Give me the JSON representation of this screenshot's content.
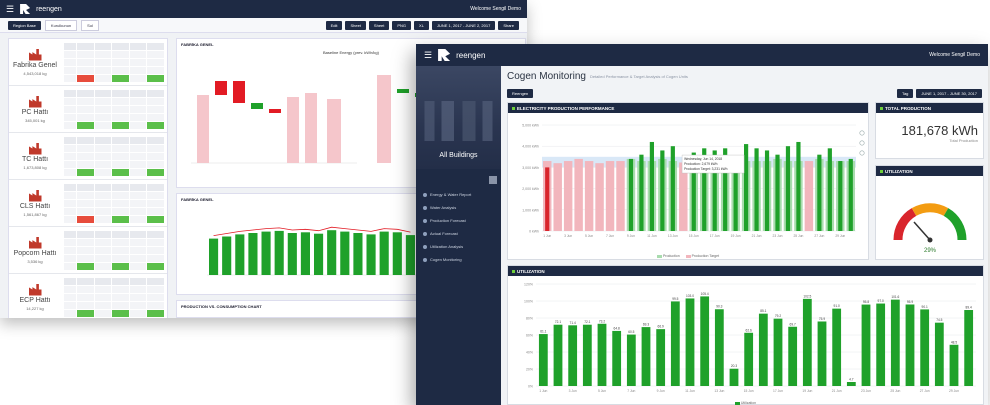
{
  "colors": {
    "navy": "#1e2a44",
    "green": "#1fa12a",
    "light_green": "#a9dcae",
    "pink": "#f2b6bd",
    "red": "#d9252c",
    "band": "#d9e8f7",
    "accent": "#6fcf3b"
  },
  "back_screen": {
    "brand": "reengen",
    "welcome": "Welcome Sengil Demo",
    "toolbar_buttons": [
      "Region Base",
      "Kurulkunun",
      "Sol"
    ],
    "right_buttons": [
      "Edit",
      "Sheet",
      "Sheet",
      "PNG",
      "XL",
      "JUNE 1, 2017 - JUNE 2, 2017",
      "Share"
    ],
    "plants": [
      {
        "name": "Fabrika Genel",
        "value": "4,543,018 kg"
      },
      {
        "name": "PC Hattı",
        "value": "345,001 kg"
      },
      {
        "name": "TC Hattı",
        "value": "1,673,808 kg"
      },
      {
        "name": "CLS Hattı",
        "value": "1,561,867 kg"
      },
      {
        "name": "Popcorn Hattı",
        "value": "3,536 kg"
      },
      {
        "name": "ECP Hattı",
        "value": "14,227 kg"
      }
    ],
    "panel1_title": "FABRİKA GENEL",
    "panel1_subtitle": "Baseline Energy (prev. kWh/kg)",
    "panel2_title": "FABRİKA GENEL",
    "panel3_title": "PRODUCTION VS. CONSUMPTION CHART"
  },
  "front_screen": {
    "brand": "reengen",
    "welcome": "Welcome Sengil Demo",
    "sidebar": {
      "hero_label": "All Buildings",
      "items": [
        "Energy & Water Report",
        "Water Analysis",
        "Production Forecast",
        "Actual Forecast",
        "Utilization Analysis",
        "Cogen Monitoring"
      ]
    },
    "page_title": "Cogen Monitoring",
    "page_subtitle": "Detailed Performance & Target Analysis of Cogen Units",
    "selector": "Reengen",
    "toolbar": {
      "tag": "Tag",
      "date_range": "JUNE 1, 2017 - JUNE 30, 2017"
    },
    "electricity_title": "ELECTRICITY PRODUCTION PERFORMANCE",
    "total_title": "TOTAL PRODUCTION",
    "total_value": "181,678 kWh",
    "total_sub": "Total Production",
    "utilization_card_title": "UTILIZATION",
    "gauge_value": "29%",
    "utilization_title": "UTILIZATION",
    "tooltip": [
      "Wednesday, Jun 14, 2018",
      "Production: 2,679 kWh",
      "Production Target: 3,231 kWh"
    ]
  },
  "chart_data": [
    {
      "type": "bar",
      "title": "ELECTRICITY PRODUCTION PERFORMANCE",
      "categories": [
        "1 Jun",
        "2 Jun",
        "3 Jun",
        "4 Jun",
        "5 Jun",
        "6 Jun",
        "7 Jun",
        "8 Jun",
        "9 Jun",
        "10 Jun",
        "11 Jun",
        "12 Jun",
        "13 Jun",
        "14 Jun",
        "15 Jun",
        "16 Jun",
        "17 Jun",
        "18 Jun",
        "19 Jun",
        "20 Jun",
        "21 Jun",
        "22 Jun",
        "23 Jun",
        "24 Jun",
        "25 Jun",
        "26 Jun",
        "27 Jun",
        "28 Jun",
        "29 Jun",
        "30 Jun"
      ],
      "series": [
        {
          "name": "Production",
          "values": [
            3000,
            2900,
            3100,
            3300,
            2500,
            2400,
            2700,
            3000,
            3400,
            3600,
            4200,
            3800,
            4000,
            1500,
            3700,
            3900,
            3800,
            3900,
            3500,
            4100,
            3900,
            3800,
            3600,
            4000,
            4200,
            2600,
            3600,
            3900,
            3300,
            3400
          ]
        },
        {
          "name": "Production Target",
          "values": [
            3300,
            3200,
            3300,
            3400,
            3300,
            3200,
            3300,
            3300,
            3400,
            3300,
            3300,
            3400,
            3300,
            3231,
            3300,
            3400,
            3300,
            3300,
            3400,
            3300,
            3300,
            3300,
            3400,
            3300,
            3300,
            3300,
            3400,
            3300,
            3300,
            3300
          ]
        }
      ],
      "legend": "bottom",
      "grid": true
    },
    {
      "type": "bar",
      "title": "UTILIZATION",
      "categories": [
        "1 Jun",
        "2 Jun",
        "3 Jun",
        "4 Jun",
        "5 Jun",
        "6 Jun",
        "7 Jun",
        "8 Jun",
        "9 Jun",
        "10 Jun",
        "11 Jun",
        "12 Jun",
        "13 Jun",
        "14 Jun",
        "15 Jun",
        "16 Jun",
        "17 Jun",
        "18 Jun",
        "19 Jun",
        "20 Jun",
        "21 Jun",
        "22 Jun",
        "23 Jun",
        "24 Jun",
        "25 Jun",
        "26 Jun",
        "27 Jun",
        "28 Jun",
        "29 Jun",
        "30 Jun"
      ],
      "series": [
        {
          "name": "Utilization",
          "values": [
            61.1,
            72.1,
            71.4,
            72.1,
            73.2,
            64.8,
            60.5,
            69.3,
            66.9,
            99.5,
            103.0,
            105.4,
            90.3,
            20.3,
            62.6,
            85.1,
            79.2,
            69.7,
            102.5,
            75.9,
            91.0,
            4.7,
            95.8,
            97.0,
            101.6,
            95.9,
            90.1,
            74.5,
            48.5,
            89.4
          ]
        }
      ],
      "legend": "bottom",
      "grid": true
    }
  ]
}
